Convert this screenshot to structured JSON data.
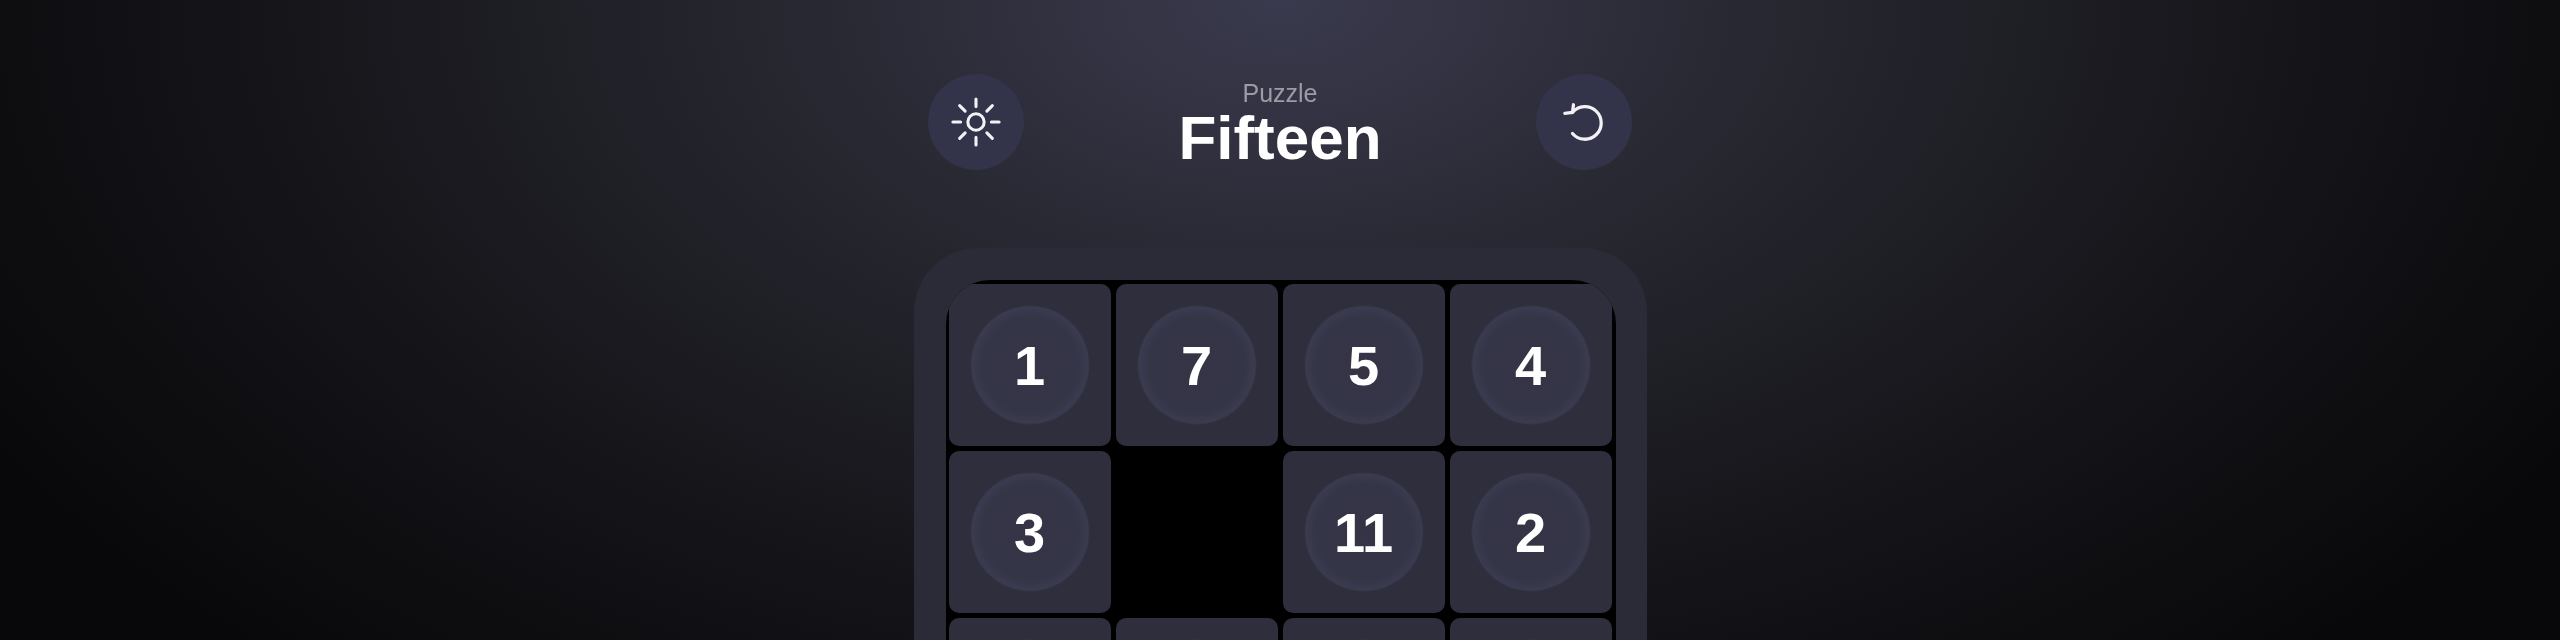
{
  "header": {
    "subtitle": "Puzzle",
    "title": "Fifteen"
  },
  "board": {
    "rows": [
      [
        {
          "kind": "tile",
          "label": "1"
        },
        {
          "kind": "tile",
          "label": "7"
        },
        {
          "kind": "tile",
          "label": "5"
        },
        {
          "kind": "tile",
          "label": "4"
        }
      ],
      [
        {
          "kind": "tile",
          "label": "3"
        },
        {
          "kind": "empty"
        },
        {
          "kind": "tile",
          "label": "11"
        },
        {
          "kind": "tile",
          "label": "2"
        }
      ],
      [
        {
          "kind": "tile"
        },
        {
          "kind": "tile"
        },
        {
          "kind": "tile"
        },
        {
          "kind": "tile"
        }
      ]
    ]
  }
}
